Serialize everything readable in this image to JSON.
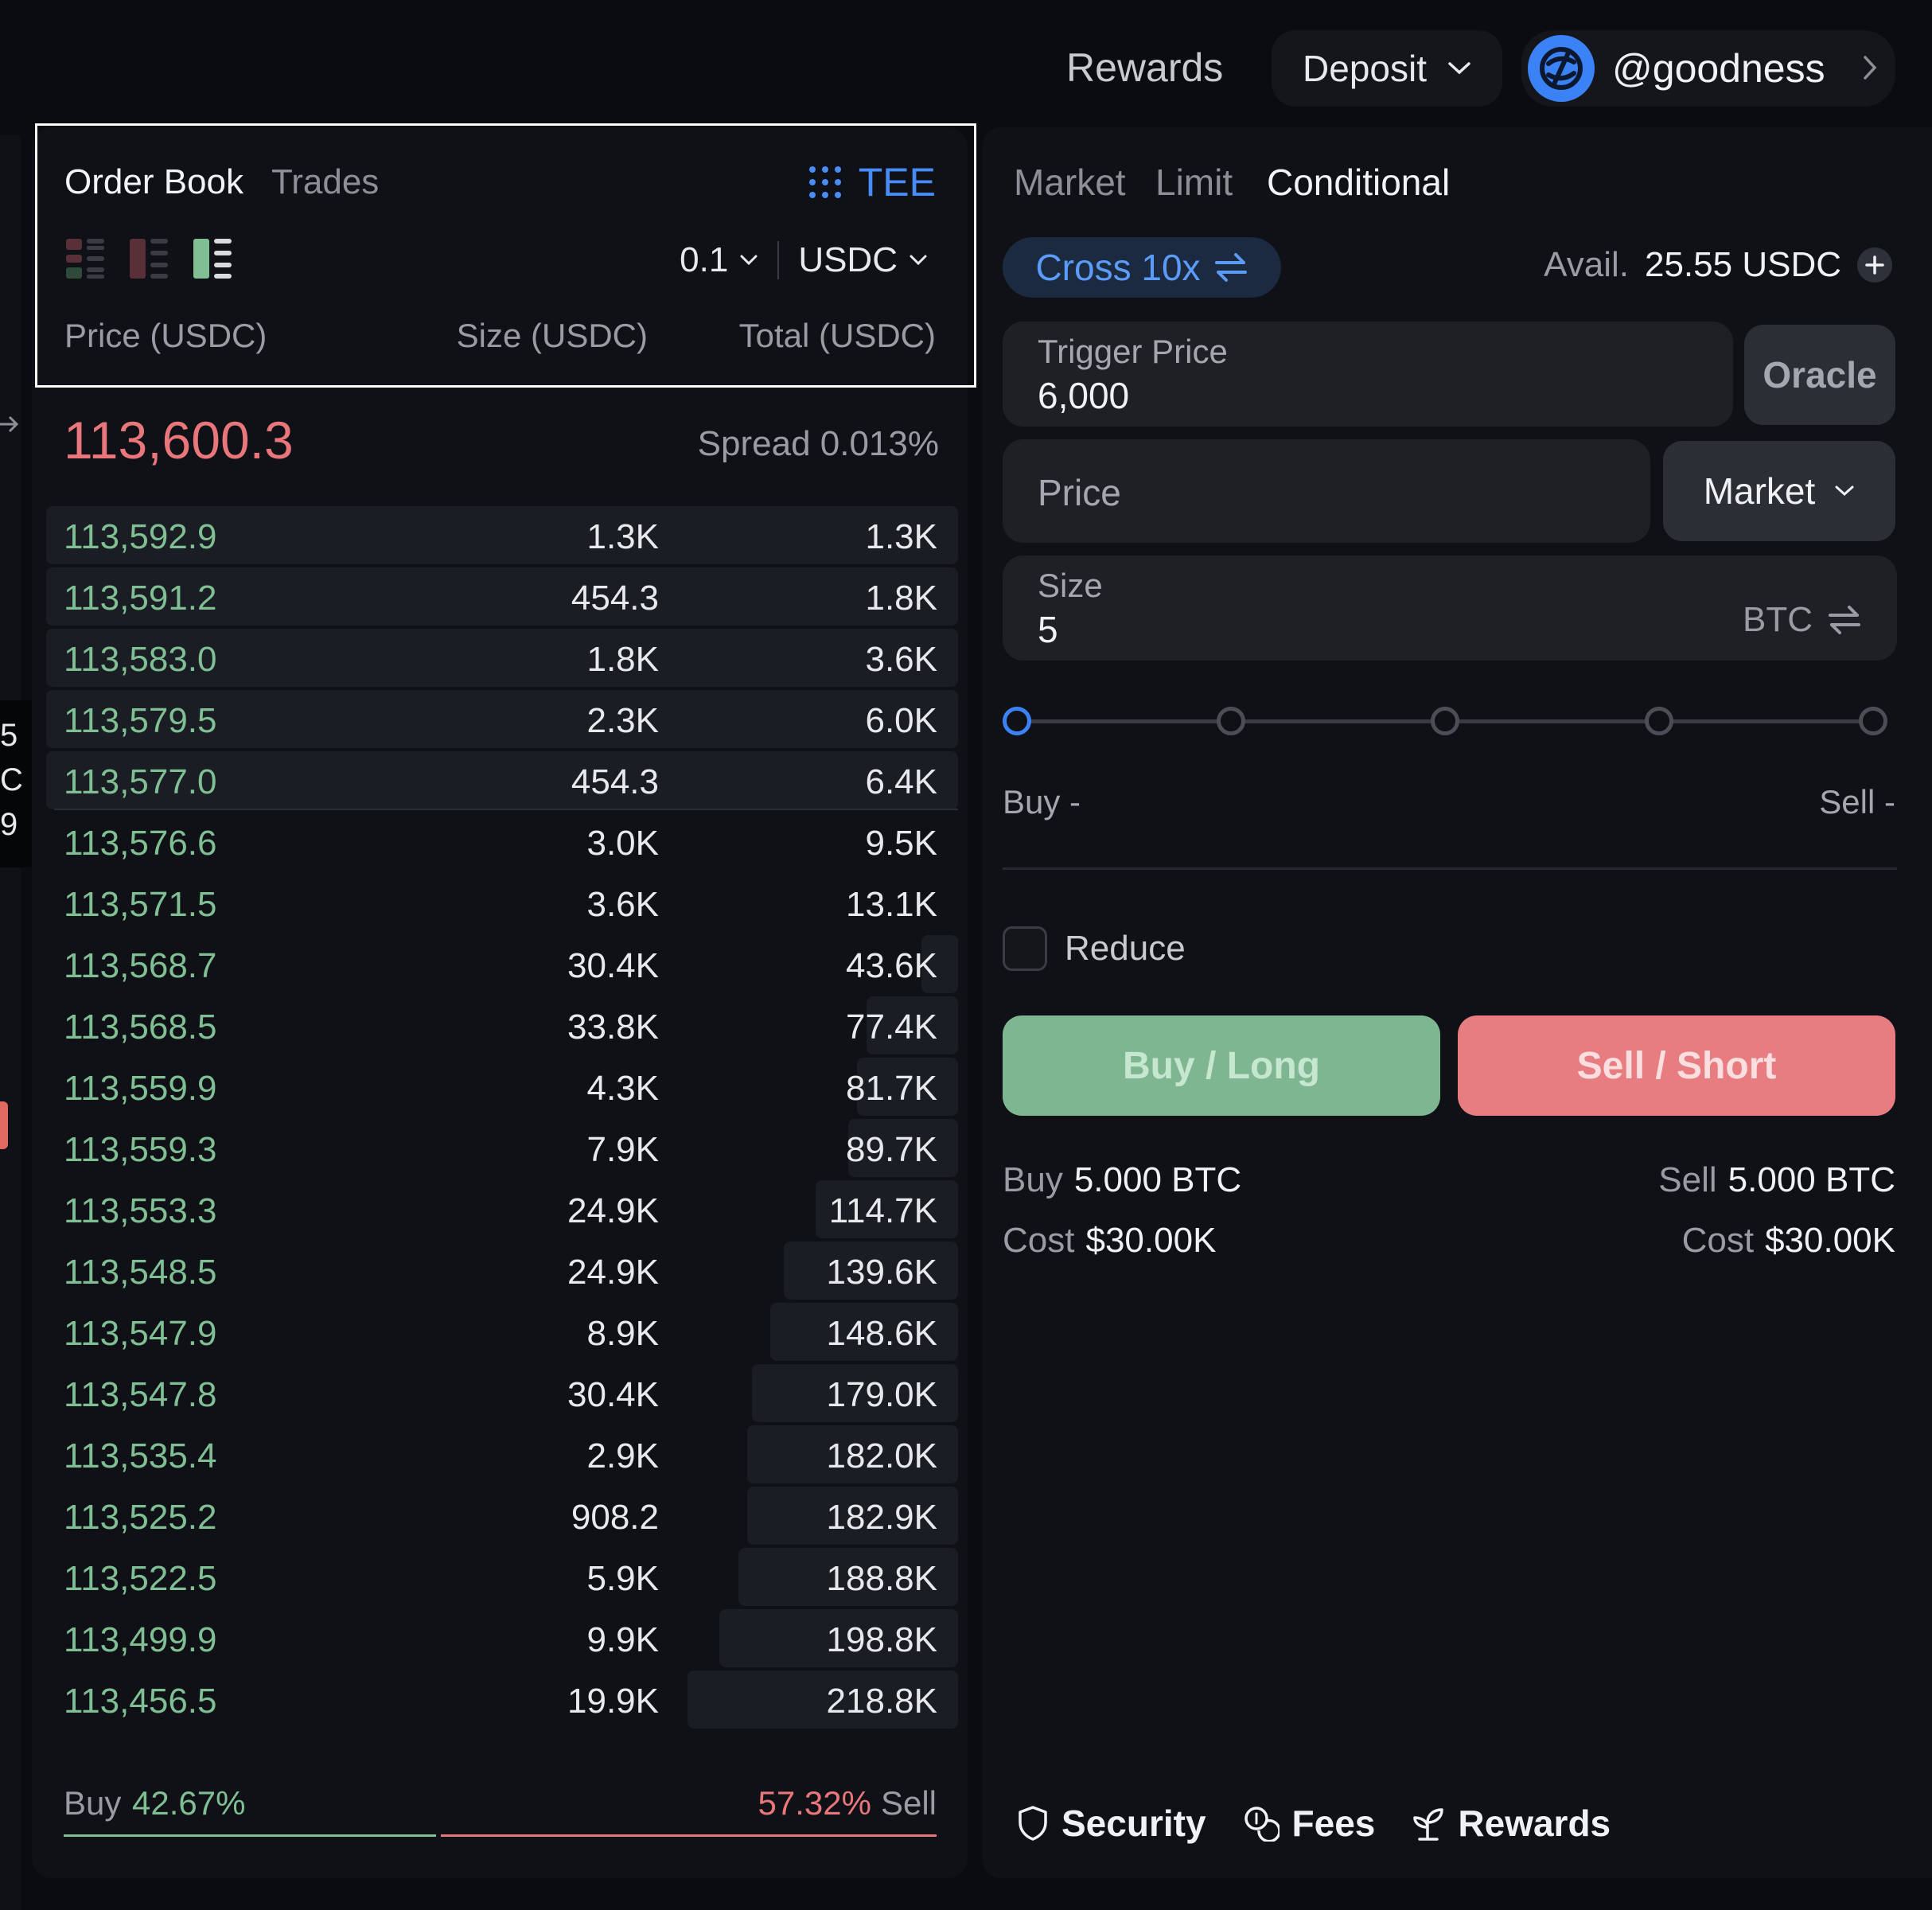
{
  "header": {
    "rewards_label": "Rewards",
    "deposit_label": "Deposit",
    "username": "@goodness"
  },
  "left_sliver": {
    "chars": [
      "5",
      "C",
      "9"
    ]
  },
  "order_book": {
    "tabs": [
      {
        "label": "Order Book",
        "active": true
      },
      {
        "label": "Trades",
        "active": false
      }
    ],
    "tee_label": "TEE",
    "tick_size": "0.1",
    "currency": "USDC",
    "columns": [
      "Price (USDC)",
      "Size (USDC)",
      "Total (USDC)"
    ],
    "mid_price": "113,600.3",
    "spread": "Spread 0.013%",
    "rows": [
      {
        "price": "113,592.9",
        "size": "1.3K",
        "total": "1.3K",
        "depth": 0.995
      },
      {
        "price": "113,591.2",
        "size": "454.3",
        "total": "1.8K",
        "depth": 0.995
      },
      {
        "price": "113,583.0",
        "size": "1.8K",
        "total": "3.6K",
        "depth": 0.995
      },
      {
        "price": "113,579.5",
        "size": "2.3K",
        "total": "6.0K",
        "depth": 0.995
      },
      {
        "price": "113,577.0",
        "size": "454.3",
        "total": "6.4K",
        "depth": 0.995
      },
      {
        "price": "113,576.6",
        "size": "3.0K",
        "total": "9.5K",
        "depth": 0
      },
      {
        "price": "113,571.5",
        "size": "3.6K",
        "total": "13.1K",
        "depth": 0
      },
      {
        "price": "113,568.7",
        "size": "30.4K",
        "total": "43.6K",
        "depth": 0.04
      },
      {
        "price": "113,568.5",
        "size": "33.8K",
        "total": "77.4K",
        "depth": 0.1
      },
      {
        "price": "113,559.9",
        "size": "4.3K",
        "total": "81.7K",
        "depth": 0.11
      },
      {
        "price": "113,559.3",
        "size": "7.9K",
        "total": "89.7K",
        "depth": 0.12
      },
      {
        "price": "113,553.3",
        "size": "24.9K",
        "total": "114.7K",
        "depth": 0.155
      },
      {
        "price": "113,548.5",
        "size": "24.9K",
        "total": "139.6K",
        "depth": 0.19
      },
      {
        "price": "113,547.9",
        "size": "8.9K",
        "total": "148.6K",
        "depth": 0.205
      },
      {
        "price": "113,547.8",
        "size": "30.4K",
        "total": "179.0K",
        "depth": 0.225
      },
      {
        "price": "113,535.4",
        "size": "2.9K",
        "total": "182.0K",
        "depth": 0.23
      },
      {
        "price": "113,525.2",
        "size": "908.2",
        "total": "182.9K",
        "depth": 0.23
      },
      {
        "price": "113,522.5",
        "size": "5.9K",
        "total": "188.8K",
        "depth": 0.24
      },
      {
        "price": "113,499.9",
        "size": "9.9K",
        "total": "198.8K",
        "depth": 0.26
      },
      {
        "price": "113,456.5",
        "size": "19.9K",
        "total": "218.8K",
        "depth": 0.295
      }
    ],
    "buy_label": "Buy",
    "buy_pct": "42.67%",
    "sell_pct": "57.32%",
    "sell_label": "Sell"
  },
  "order_form": {
    "tabs": [
      {
        "label": "Market",
        "active": false
      },
      {
        "label": "Limit",
        "active": false
      },
      {
        "label": "Conditional",
        "active": true
      }
    ],
    "margin_mode": "Cross 10x",
    "avail_label": "Avail.",
    "avail_value": "25.55 USDC",
    "trigger_label": "Trigger Price",
    "trigger_value": "6,000",
    "oracle_label": "Oracle",
    "price_placeholder": "Price",
    "price_type": "Market",
    "size_label": "Size",
    "size_value": "5",
    "size_unit": "BTC",
    "slider_level": 0,
    "buy_info": "Buy -",
    "sell_info": "Sell -",
    "reduce_label": "Reduce",
    "reduce_checked": false,
    "buy_button": "Buy / Long",
    "sell_button": "Sell / Short",
    "summary": {
      "buy_key": "Buy",
      "buy_val": "5.000 BTC",
      "sell_key": "Sell",
      "sell_val": "5.000 BTC",
      "cost_key": "Cost",
      "buy_cost": "$30.00K",
      "sell_cost": "$30.00K"
    },
    "footer": [
      "Security",
      "Fees",
      "Rewards"
    ]
  },
  "colors": {
    "buy_green": "#7fbf93",
    "sell_red": "#e8767a",
    "accent_blue": "#3b82f6"
  }
}
